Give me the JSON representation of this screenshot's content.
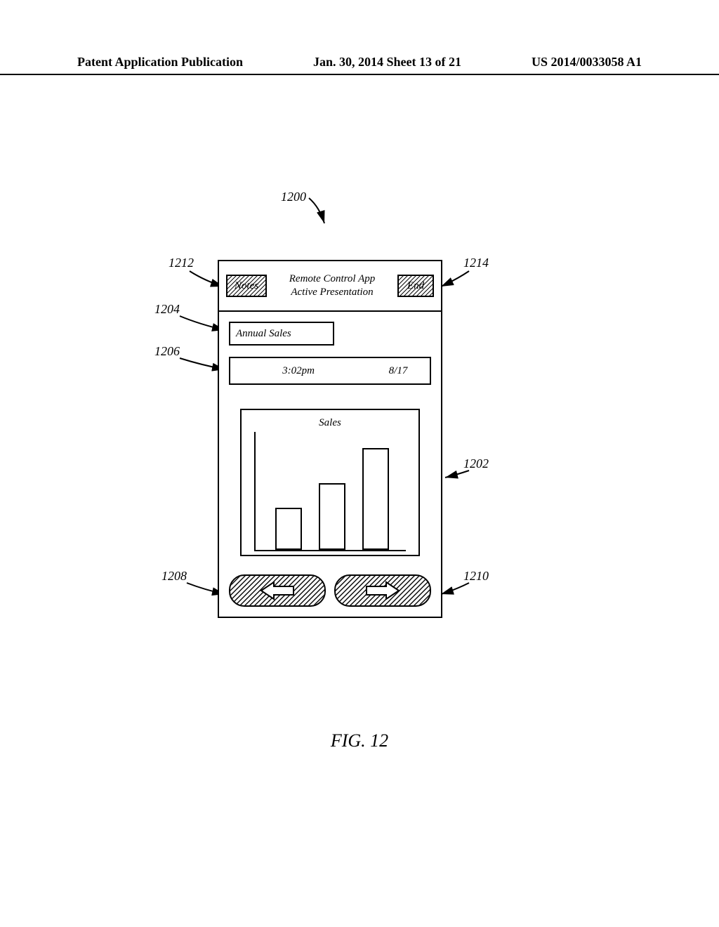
{
  "header": {
    "left": "Patent Application Publication",
    "center": "Jan. 30, 2014  Sheet 13 of 21",
    "right": "US 2014/0033058 A1"
  },
  "figure_label": "FIG. 12",
  "callouts": {
    "c1200": "1200",
    "c1212": "1212",
    "c1214": "1214",
    "c1204": "1204",
    "c1206": "1206",
    "c1202": "1202",
    "c1208": "1208",
    "c1210": "1210"
  },
  "app": {
    "title_line1": "Remote Control App",
    "title_line2": "Active Presentation",
    "notes_btn": "Notes",
    "end_btn": "End",
    "slide_title": "Annual Sales",
    "time": "3:02pm",
    "slide_count": "8/17"
  },
  "chart_data": {
    "type": "bar",
    "title": "Sales",
    "categories": [
      "",
      "",
      ""
    ],
    "values": [
      60,
      95,
      145
    ],
    "xlabel": "",
    "ylabel": "",
    "ylim": [
      0,
      170
    ]
  }
}
